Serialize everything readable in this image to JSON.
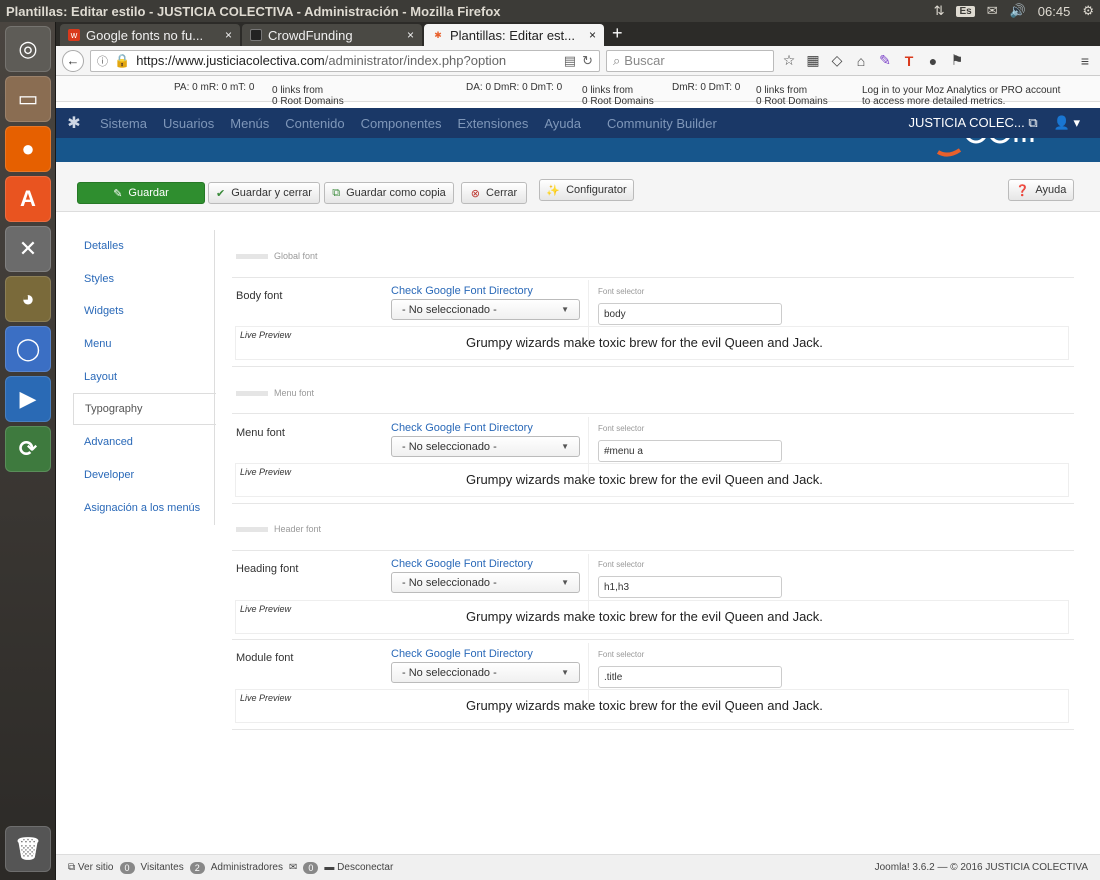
{
  "window_title": "Plantillas: Editar estilo - JUSTICIA COLECTIVA - Administración - Mozilla Firefox",
  "os_tray": {
    "keyboard": "Es",
    "time": "06:45"
  },
  "launcher": [
    "ubuntu-icon",
    "files-icon",
    "firefox-icon",
    "software-center-icon",
    "settings-icon",
    "gimp-icon",
    "chromium-icon",
    "media-player-icon",
    "update-icon",
    "trash-icon"
  ],
  "tabs": [
    {
      "label": "Google fonts no fu...",
      "icon": "w",
      "active": false
    },
    {
      "label": "CrowdFunding",
      "icon": "",
      "active": false
    },
    {
      "label": "Plantillas: Editar est...",
      "icon": "",
      "active": true
    }
  ],
  "url": {
    "host": "https://www.justiciacolectiva.com",
    "path": "/administrator/index.php?option"
  },
  "search_placeholder": "Buscar",
  "mozbar": {
    "m1": "PA: 0   mR: 0   mT: 0",
    "m1b": "0 links from",
    "m1c": "0 Root Domains",
    "m2": "DA: 0   DmR: 0   DmT: 0",
    "m2b": "0 links from",
    "m2c": "0 Root Domains",
    "m3": "DmR: 0   DmT: 0",
    "m3b": "0 links from",
    "m3c": "0 Root Domains",
    "promo1": "Log in to your Moz Analytics or PRO account",
    "promo2": "to access more detailed metrics."
  },
  "jnav": {
    "items": [
      "Sistema",
      "Usuarios",
      "Menús",
      "Contenido",
      "Componentes",
      "Extensiones",
      "Ayuda",
      "Community Builder"
    ],
    "site": "JUSTICIA COLEC..."
  },
  "toolbar": {
    "save": "Guardar",
    "save_close": "Guardar y cerrar",
    "save_copy": "Guardar como copia",
    "close": "Cerrar",
    "configurator": "Configurator",
    "help": "Ayuda"
  },
  "sidetabs": [
    "Detalles",
    "Styles",
    "Widgets",
    "Menu",
    "Layout",
    "Typography",
    "Advanced",
    "Developer",
    "Asignación a los menús"
  ],
  "active_tab": "Typography",
  "common": {
    "google_link": "Check Google Font Directory",
    "select_value": "- No seleccionado -",
    "fs_label": "Font selector",
    "live_preview": "Live Preview",
    "preview_text": "Grumpy wizards make toxic brew for the evil Queen and Jack."
  },
  "sections": {
    "global": "Global font",
    "menu": "Menu font",
    "header": "Header font"
  },
  "fonts": [
    {
      "label": "Body font",
      "selector": "body"
    },
    {
      "label": "Menu font",
      "selector": "#menu a"
    },
    {
      "label": "Heading font",
      "selector": "h1,h3"
    },
    {
      "label": "Module font",
      "selector": ".title"
    }
  ],
  "status": {
    "view_site": "Ver sitio",
    "visitors_count": "0",
    "visitors": "Visitantes",
    "admins_count": "2",
    "admins": "Administradores",
    "messages_count": "0",
    "logout": "Desconectar",
    "footer": "Joomla! 3.6.2 — © 2016 JUSTICIA COLECTIVA"
  }
}
